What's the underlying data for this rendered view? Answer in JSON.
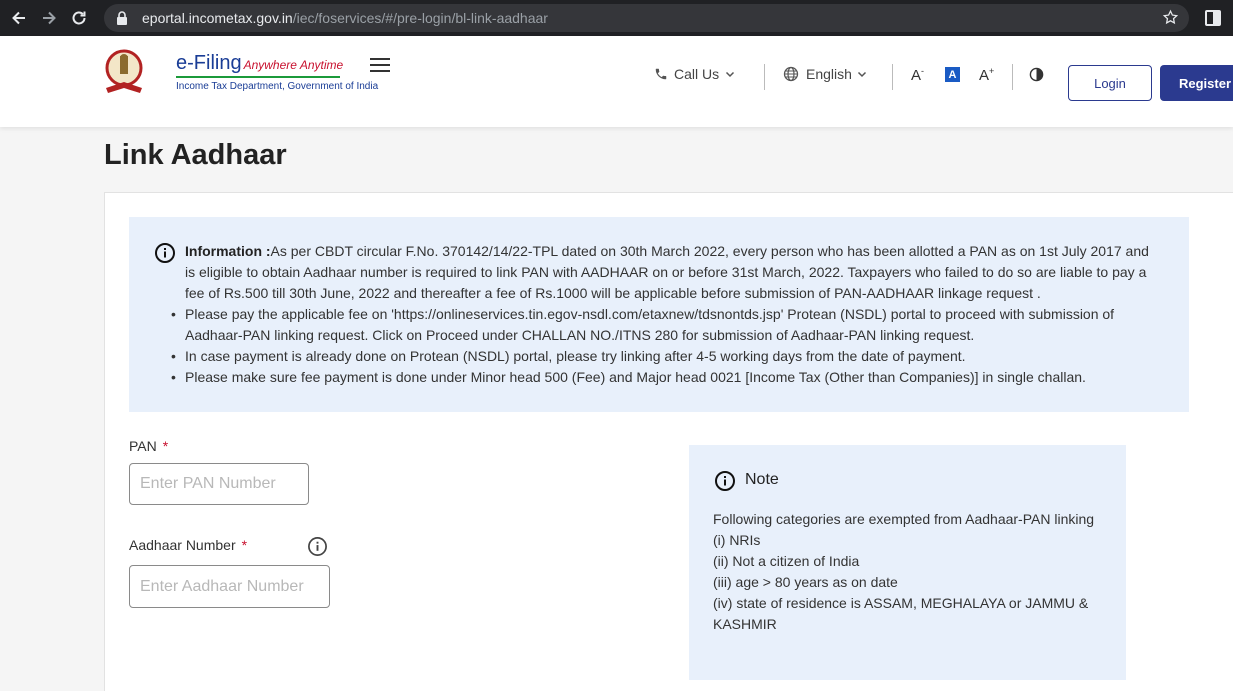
{
  "browser": {
    "url_host": "eportal.incometax.gov.in",
    "url_path": "/iec/foservices/#/pre-login/bl-link-aadhaar"
  },
  "header": {
    "brand_title": "e-Filing",
    "brand_tagline": "Anywhere Anytime",
    "brand_subtitle": "Income Tax Department, Government of India",
    "call_us": "Call Us",
    "language": "English",
    "font_decrease": "A",
    "font_normal": "A",
    "font_increase": "A",
    "login": "Login",
    "register": "Register"
  },
  "page": {
    "title": "Link Aadhaar"
  },
  "info": {
    "lead_label": "Information :",
    "lead_text": "As per CBDT circular F.No. 370142/14/22-TPL dated on 30th March 2022, every person who has been allotted a PAN as on 1st July 2017 and is eligible to obtain Aadhaar number is required to link PAN with AADHAAR on or before 31st March, 2022. Taxpayers who failed to do so are liable to pay a fee of Rs.500 till 30th June, 2022 and thereafter a fee of Rs.1000 will be applicable before submission of PAN-AADHAAR linkage request .",
    "bullets": [
      "Please pay the applicable fee on 'https://onlineservices.tin.egov-nsdl.com/etaxnew/tdsnontds.jsp' Protean (NSDL) portal to proceed with submission of Aadhaar-PAN linking request. Click on Proceed under CHALLAN NO./ITNS 280 for submission of Aadhaar-PAN linking request.",
      "In case payment is already done on Protean (NSDL) portal, please try linking after 4-5 working days from the date of payment.",
      "Please make sure fee payment is done under Minor head 500 (Fee) and Major head 0021 [Income Tax (Other than Companies)] in single challan."
    ]
  },
  "form": {
    "pan_label": "PAN",
    "pan_placeholder": "Enter PAN Number",
    "aadhaar_label": "Aadhaar Number",
    "aadhaar_placeholder": "Enter Aadhaar Number",
    "required_mark": "*"
  },
  "note": {
    "title": "Note",
    "lines": [
      "Following categories are exempted from Aadhaar-PAN linking",
      "(i) NRIs",
      "(ii) Not a citizen of India",
      "(iii) age > 80 years as on date",
      "(iv) state of residence is ASSAM, MEGHALAYA or JAMMU & KASHMIR"
    ]
  },
  "colors": {
    "primary": "#2b3a8f",
    "info_bg": "#e8f0fb",
    "required": "#c8102e"
  }
}
